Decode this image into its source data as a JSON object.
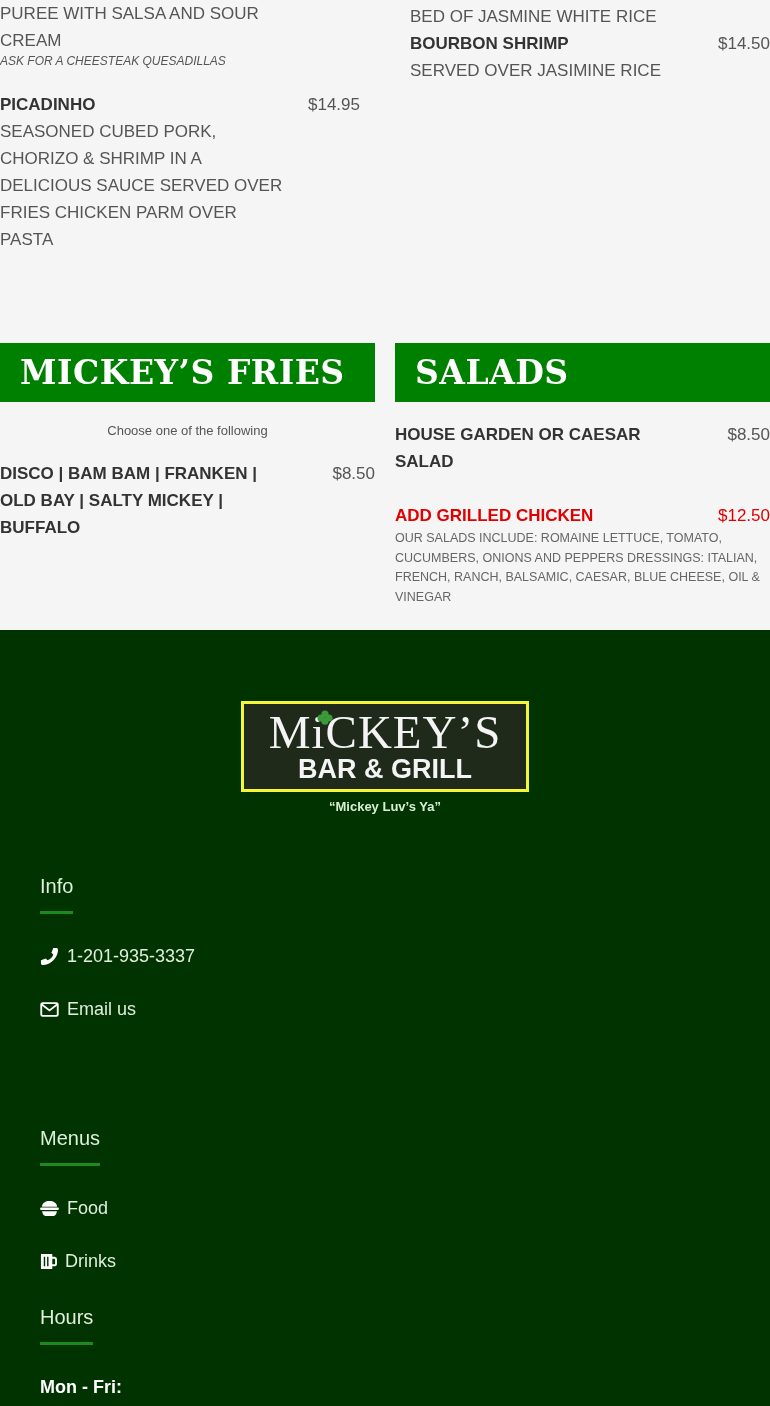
{
  "previous_section": {
    "columns": [
      {
        "entries": [
          {
            "kind": "description",
            "text": "PUREE WITH SALSA AND SOUR CREAM"
          },
          {
            "kind": "note",
            "text": "ASK FOR A CHEESTEAK QUESADILLAS"
          },
          {
            "kind": "item",
            "name": "PICADINHO",
            "price": "$14.95",
            "description": "SEASONED CUBED PORK, CHORIZO & SHRIMP IN A DELICIOUS SAUCE SERVED OVER FRIES CHICKEN PARM OVER PASTA"
          }
        ]
      },
      {
        "entries": [
          {
            "kind": "description",
            "text": "BED OF JASMINE WHITE RICE"
          },
          {
            "kind": "item",
            "name": "BOURBON SHRIMP",
            "price": "$14.50",
            "description": "SERVED OVER JASIMINE RICE"
          }
        ]
      }
    ]
  },
  "sections": [
    {
      "title": "MICKEY’S FRIES",
      "intro": "Choose one of the following",
      "entries": [
        {
          "kind": "item",
          "name": "DISCO | BAM BAM | FRANKEN | OLD BAY | SALTY MICKEY | BUFFALO",
          "price": "$8.50"
        }
      ]
    },
    {
      "title": "SALADS",
      "entries": [
        {
          "kind": "item",
          "name": "HOUSE GARDEN OR CAESAR SALAD",
          "price": "$8.50"
        },
        {
          "kind": "addon",
          "name": "ADD GRILLED CHICKEN",
          "price": "$12.50"
        },
        {
          "kind": "small",
          "text": "OUR SALADS INCLUDE: ROMAINE LETTUCE, TOMATO, CUCUMBERS, ONIONS AND PEPPERS DRESSINGS: ITALIAN, FRENCH, RANCH, BALSAMIC, CAESAR, BLUE CHEESE, OIL & VINEGAR"
        }
      ]
    }
  ],
  "footer": {
    "logo": {
      "name": "MiCKEY’S",
      "subtitle": "BAR & GRILL"
    },
    "tagline": "“Mickey Luv’s Ya”",
    "widgets": [
      {
        "title": "Info",
        "links": [
          {
            "kind": "phone",
            "text": "1-201-935-3337"
          },
          {
            "kind": "email",
            "text": "Email us"
          }
        ]
      },
      {
        "title": "Menus",
        "links": [
          {
            "kind": "food",
            "text": "Food"
          },
          {
            "kind": "drinks",
            "text": "Drinks"
          }
        ]
      },
      {
        "title": "Hours",
        "links": [
          {
            "kind": "label",
            "text": "Mon - Fri:"
          }
        ]
      }
    ]
  }
}
